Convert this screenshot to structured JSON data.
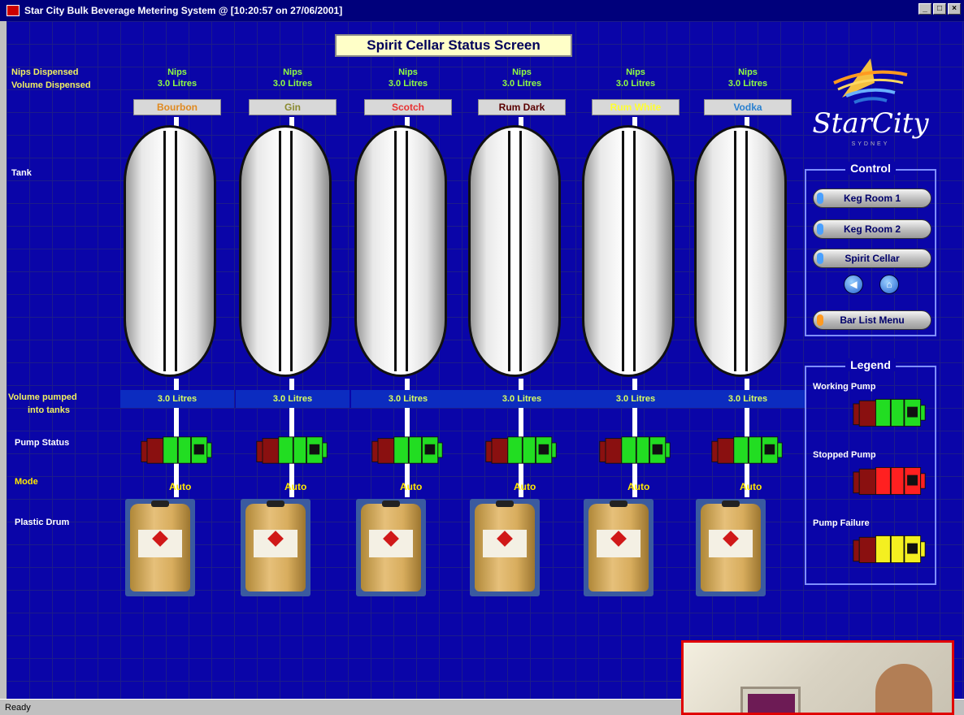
{
  "window": {
    "title": "Star City Bulk Beverage Metering System @ [10:20:57 on 27/06/2001]",
    "status": "Ready"
  },
  "screen": {
    "heading": "Spirit Cellar Status Screen",
    "labels": {
      "nips_dispensed": "Nips Dispensed",
      "volume_dispensed": "Volume Dispensed",
      "tank": "Tank",
      "volume_pumped": "Volume pumped",
      "into_tanks": "into tanks",
      "pump_status": "Pump Status",
      "mode": "Mode",
      "plastic_drum": "Plastic Drum"
    },
    "tanks": [
      {
        "name": "Bourbon",
        "name_color": "#e08a20",
        "nips": "Nips",
        "volume_dispensed": "3.0 Litres",
        "volume_pumped": "3.0 Litres",
        "pump_status": "working",
        "mode": "Auto"
      },
      {
        "name": "Gin",
        "name_color": "#8a8a30",
        "nips": "Nips",
        "volume_dispensed": "3.0 Litres",
        "volume_pumped": "3.0 Litres",
        "pump_status": "working",
        "mode": "Auto"
      },
      {
        "name": "Scotch",
        "name_color": "#e83030",
        "nips": "Nips",
        "volume_dispensed": "3.0 Litres",
        "volume_pumped": "3.0 Litres",
        "pump_status": "working",
        "mode": "Auto"
      },
      {
        "name": "Rum Dark",
        "name_color": "#5a0000",
        "nips": "Nips",
        "volume_dispensed": "3.0 Litres",
        "volume_pumped": "3.0 Litres",
        "pump_status": "working",
        "mode": "Auto"
      },
      {
        "name": "Rum White",
        "name_color": "#ffff30",
        "nips": "Nips",
        "volume_dispensed": "3.0 Litres",
        "volume_pumped": "3.0 Litres",
        "pump_status": "working",
        "mode": "Auto"
      },
      {
        "name": "Vodka",
        "name_color": "#2a80d0",
        "nips": "Nips",
        "volume_dispensed": "3.0 Litres",
        "volume_pumped": "3.0 Litres",
        "pump_status": "working",
        "mode": "Auto"
      }
    ]
  },
  "logo": {
    "text": "StarCity",
    "sub": "SYDNEY"
  },
  "control": {
    "title": "Control",
    "keg_room_1": "Keg Room 1",
    "keg_room_2": "Keg Room 2",
    "spirit_cellar": "Spirit Cellar",
    "bar_list_menu": "Bar List Menu",
    "back_icon": "back-arrow-icon",
    "home_icon": "home-icon"
  },
  "legend": {
    "title": "Legend",
    "working": "Working Pump",
    "stopped": "Stopped Pump",
    "failure": "Pump Failure",
    "colors": {
      "working": "#22dd22",
      "stopped": "#ff2020",
      "failure": "#f4f020",
      "motor": "#8a1010"
    }
  }
}
